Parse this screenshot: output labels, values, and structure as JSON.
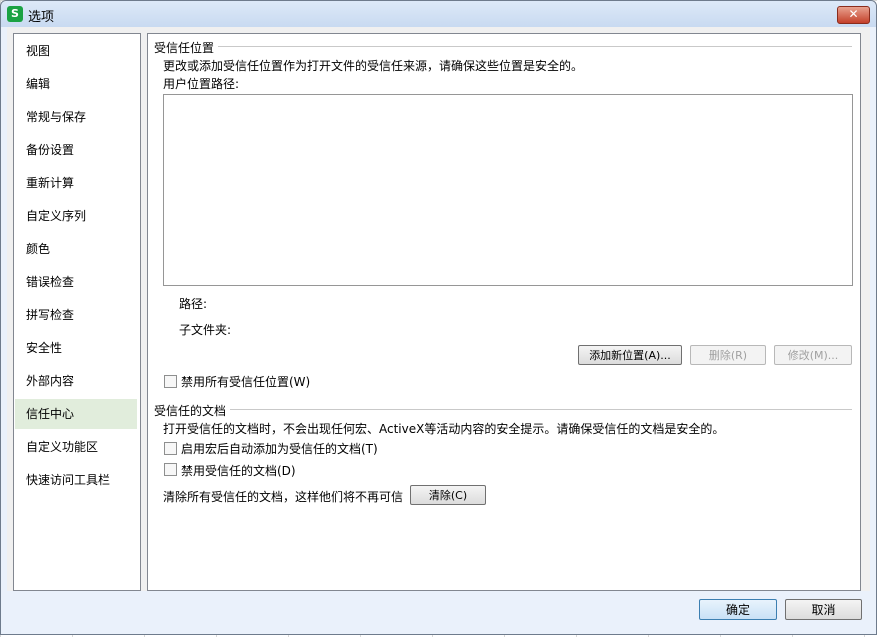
{
  "window": {
    "title": "选项",
    "app_icon_letter": "S",
    "close_glyph": "✕"
  },
  "sidebar": {
    "items": [
      {
        "label": "视图"
      },
      {
        "label": "编辑"
      },
      {
        "label": "常规与保存"
      },
      {
        "label": "备份设置"
      },
      {
        "label": "重新计算"
      },
      {
        "label": "自定义序列"
      },
      {
        "label": "颜色"
      },
      {
        "label": "错误检查"
      },
      {
        "label": "拼写检查"
      },
      {
        "label": "安全性"
      },
      {
        "label": "外部内容"
      },
      {
        "label": "信任中心"
      },
      {
        "label": "自定义功能区"
      },
      {
        "label": "快速访问工具栏"
      }
    ],
    "active_index": 11
  },
  "trusted_locations": {
    "heading": "受信任位置",
    "description": "更改或添加受信任位置作为打开文件的受信任来源，请确保这些位置是安全的。",
    "list_label": "用户位置路径:",
    "path_label": "路径:",
    "subfolder_label": "子文件夹:",
    "add_button": "添加新位置(A)...",
    "delete_button": "删除(R)",
    "modify_button": "修改(M)...",
    "disable_all_checkbox": "禁用所有受信任位置(W)"
  },
  "trusted_documents": {
    "heading": "受信任的文档",
    "description": "打开受信任的文档时，不会出现任何宏、ActiveX等活动内容的安全提示。请确保受信任的文档是安全的。",
    "auto_add_checkbox": "启用宏后自动添加为受信任的文档(T)",
    "disable_checkbox": "禁用受信任的文档(D)",
    "clear_text": "清除所有受信任的文档，这样他们将不再可信",
    "clear_button": "清除(C)"
  },
  "footer": {
    "ok_button": "确定",
    "cancel_button": "取消"
  }
}
